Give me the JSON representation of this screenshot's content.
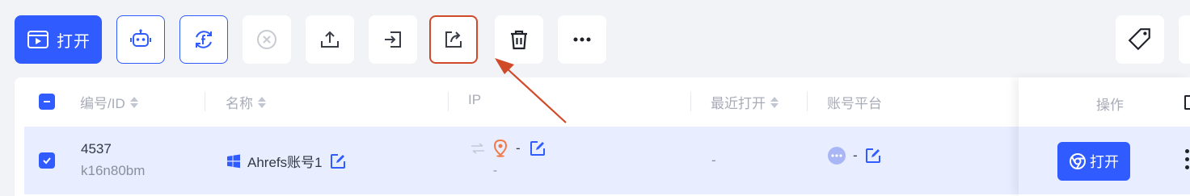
{
  "toolbar": {
    "open_label": "打开",
    "buttons": [
      {
        "name": "robot-icon"
      },
      {
        "name": "facebook-sync-icon"
      },
      {
        "name": "close-circle-icon"
      },
      {
        "name": "upload-icon"
      },
      {
        "name": "import-icon"
      },
      {
        "name": "share-export-icon"
      },
      {
        "name": "trash-icon"
      },
      {
        "name": "more-icon"
      }
    ],
    "tag_icon": "tag-icon"
  },
  "table": {
    "headers": {
      "id": "编号/ID",
      "name": "名称",
      "ip": "IP",
      "last_open": "最近打开",
      "platform": "账号平台",
      "ops": "操作"
    },
    "rows": [
      {
        "id": "4537",
        "code": "k16n80bm",
        "name": "Ahrefs账号1",
        "ip_value": "-",
        "ip_sub": "-",
        "last_open": "-",
        "platform_value": "-",
        "open_label": "打开"
      }
    ]
  },
  "colors": {
    "primary": "#2f5bff",
    "highlight": "#d04a2a",
    "row_selected": "#e8edff"
  }
}
